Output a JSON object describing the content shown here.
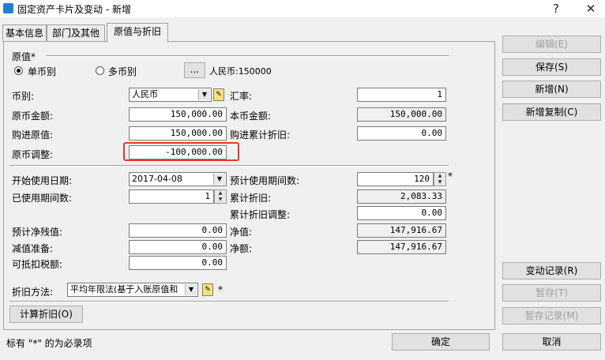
{
  "window": {
    "title": "固定资产卡片及变动 - 新增",
    "help": "?",
    "close": "✕"
  },
  "tabs": [
    {
      "label": "基本信息"
    },
    {
      "label": "部门及其他"
    },
    {
      "label": "原值与折旧"
    }
  ],
  "original_value": {
    "group_label": "原值*",
    "single_currency_label": "单币别",
    "multi_currency_label": "多币别",
    "selected": "单币别",
    "browse_label": "...",
    "summary": "人民币:150000"
  },
  "fields": {
    "currency_label": "币别:",
    "currency_value": "人民币",
    "rate_label": "汇率:",
    "rate_value": "1",
    "orig_amount_label": "原币金额:",
    "orig_amount_value": "150,000.00",
    "local_amount_label": "本币金额:",
    "local_amount_value": "150,000.00",
    "purchase_value_label": "购进原值:",
    "purchase_value_value": "150,000.00",
    "purchase_depr_label": "购进累计折旧:",
    "purchase_depr_value": "0.00",
    "orig_adjust_label": "原币调整:",
    "orig_adjust_value": "-100,000.00",
    "start_date_label": "开始使用日期:",
    "start_date_value": "2017-04-08",
    "est_periods_label": "预计使用期间数:",
    "est_periods_value": "120",
    "est_periods_required": "*",
    "used_periods_label": "已使用期间数:",
    "used_periods_value": "1",
    "accum_depr_label": "累计折旧:",
    "accum_depr_value": "2,083.33",
    "accum_adjust_label": "累计折旧调整:",
    "accum_adjust_value": "0.00",
    "salvage_label": "预计净残值:",
    "salvage_value": "0.00",
    "net_value_label": "净值:",
    "net_value_value": "147,916.67",
    "impair_label": "减值准备:",
    "impair_value": "0.00",
    "net_amount_label": "净额:",
    "net_amount_value": "147,916.67",
    "tax_label": "可抵扣税额:",
    "tax_value": "0.00",
    "method_label": "折旧方法:",
    "method_value": "平均年限法(基于入账原值和",
    "method_required": "*"
  },
  "calc_button": "计算折旧(O)",
  "side_buttons": {
    "edit": "编辑(E)",
    "save": "保存(S)",
    "new": "新增(N)",
    "new_copy": "新增复制(C)",
    "change_log": "变动记录(R)",
    "hold": "暂存(T)",
    "hold_log": "暂存记录(M)"
  },
  "footer": {
    "note": "标有 \"*\" 的为必录项",
    "ok": "确定",
    "cancel": "取消"
  }
}
